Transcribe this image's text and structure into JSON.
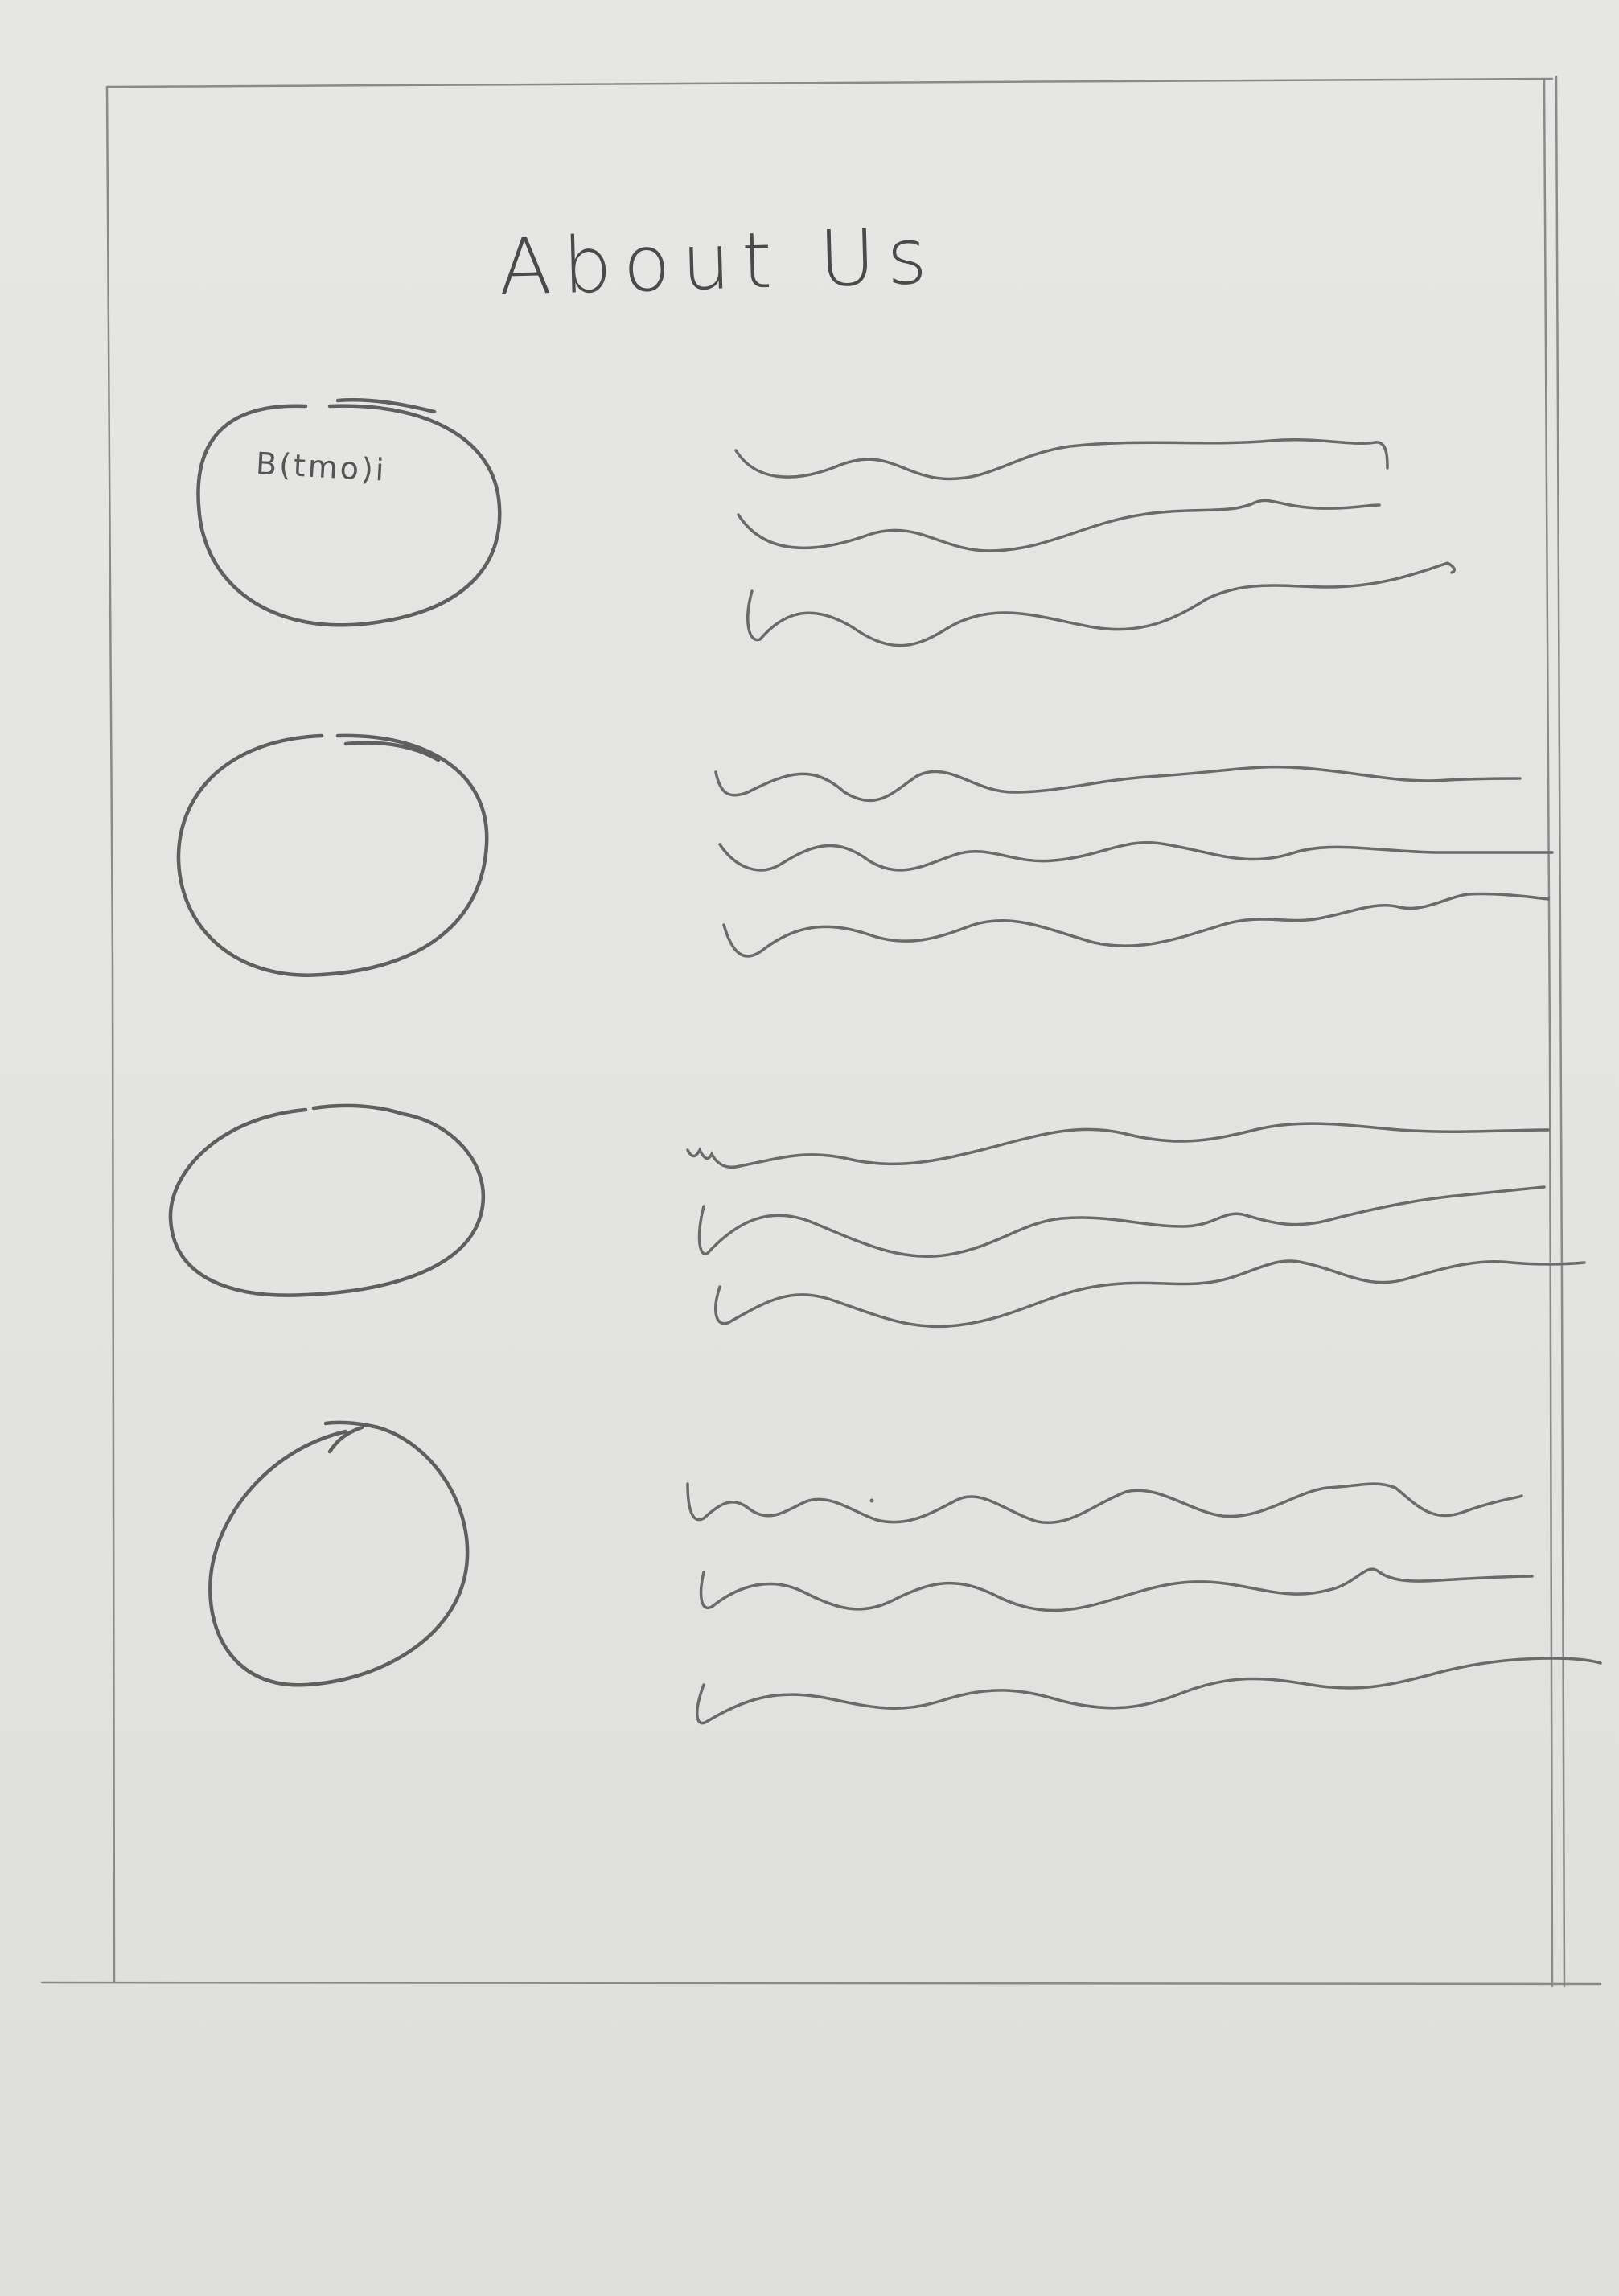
{
  "page": {
    "title": "About Us"
  },
  "members": [
    {
      "avatar_label": "B(tmo)i",
      "text_lines": 3
    },
    {
      "avatar_label": "",
      "text_lines": 3
    },
    {
      "avatar_label": "",
      "text_lines": 3
    },
    {
      "avatar_label": "",
      "text_lines": 3
    }
  ]
}
